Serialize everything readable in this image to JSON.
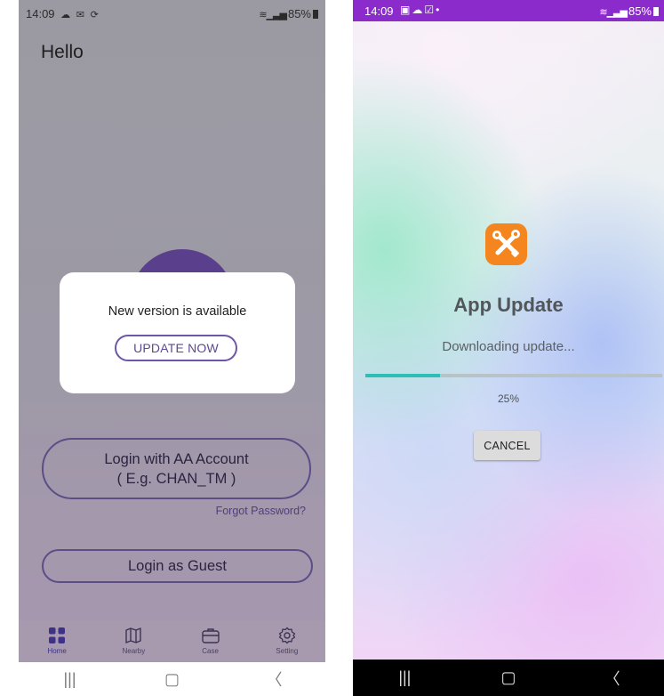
{
  "left_screen": {
    "status": {
      "time": "14:09",
      "icons": [
        "cloud-icon",
        "mail-icon",
        "sync-icon"
      ],
      "battery": "85%"
    },
    "greeting": "Hello",
    "dialog": {
      "message": "New version is available",
      "button": "UPDATE NOW"
    },
    "login_aa": {
      "line1": "Login with AA Account",
      "line2": "( E.g. CHAN_TM )"
    },
    "forgot_password": "Forgot Password?",
    "login_guest": "Login as Guest",
    "nav": [
      {
        "label": "Home",
        "icon": "grid-icon",
        "active": true
      },
      {
        "label": "Nearby",
        "icon": "map-icon",
        "active": false
      },
      {
        "label": "Case",
        "icon": "briefcase-icon",
        "active": false
      },
      {
        "label": "Setting",
        "icon": "gear-icon",
        "active": false
      }
    ],
    "colors": {
      "accent": "#5a3f8d",
      "outline": "#5c4d85"
    }
  },
  "right_screen": {
    "status": {
      "time": "14:09",
      "battery": "85%",
      "bar_color": "#8c2bcc"
    },
    "app_icon": "tools-icon",
    "title": "App Update",
    "status_text": "Downloading update...",
    "progress": {
      "fraction": 0.25,
      "label": "25%"
    },
    "cancel_button": "CANCEL",
    "colors": {
      "progress": "#2dbfb6",
      "icon_bg": "#f5861f"
    }
  }
}
